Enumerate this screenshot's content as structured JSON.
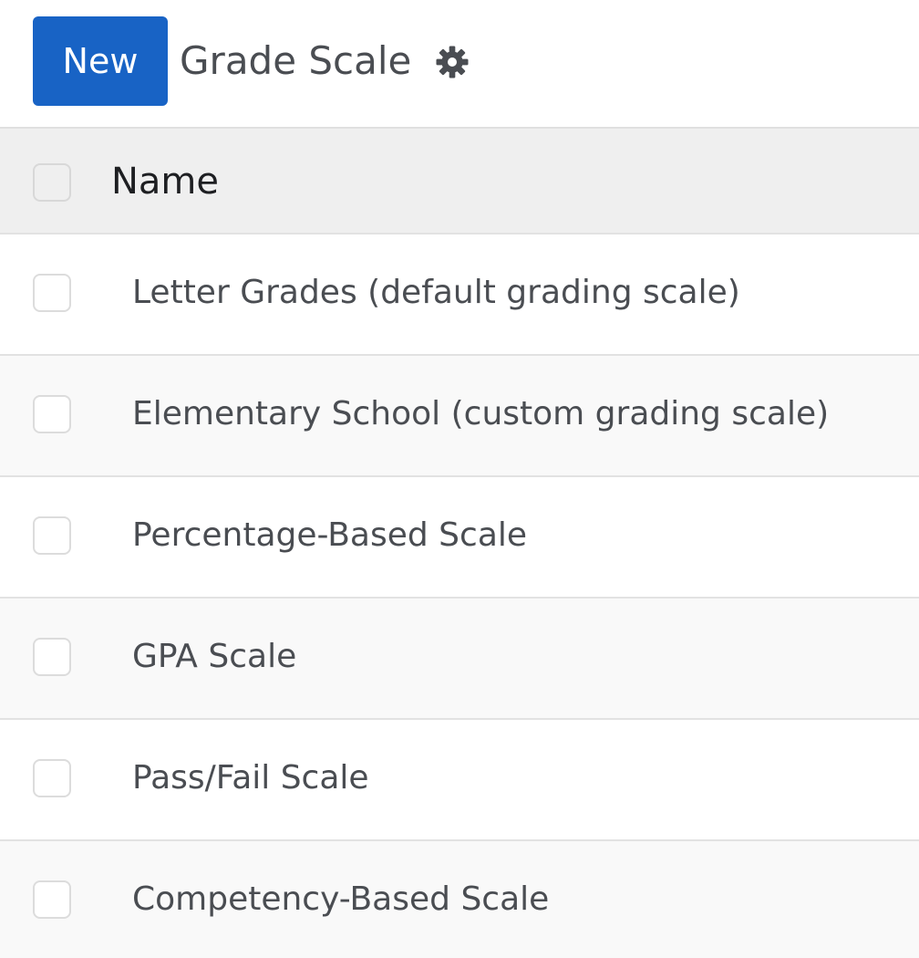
{
  "control_panel": {
    "new_button_label": "New",
    "title": "Grade Scale",
    "settings_icon": "gear-icon"
  },
  "table": {
    "columns": [
      "Name"
    ],
    "rows": [
      {
        "name": "Letter Grades (default grading scale)"
      },
      {
        "name": "Elementary School (custom grading scale)"
      },
      {
        "name": "Percentage-Based Scale"
      },
      {
        "name": "GPA Scale"
      },
      {
        "name": "Pass/Fail Scale"
      },
      {
        "name": "Competency-Based Scale"
      }
    ]
  },
  "colors": {
    "primary": "#1863c5",
    "header_bg": "#efefef",
    "row_alt_bg": "#f9f9f9",
    "text": "#4a4d52"
  }
}
